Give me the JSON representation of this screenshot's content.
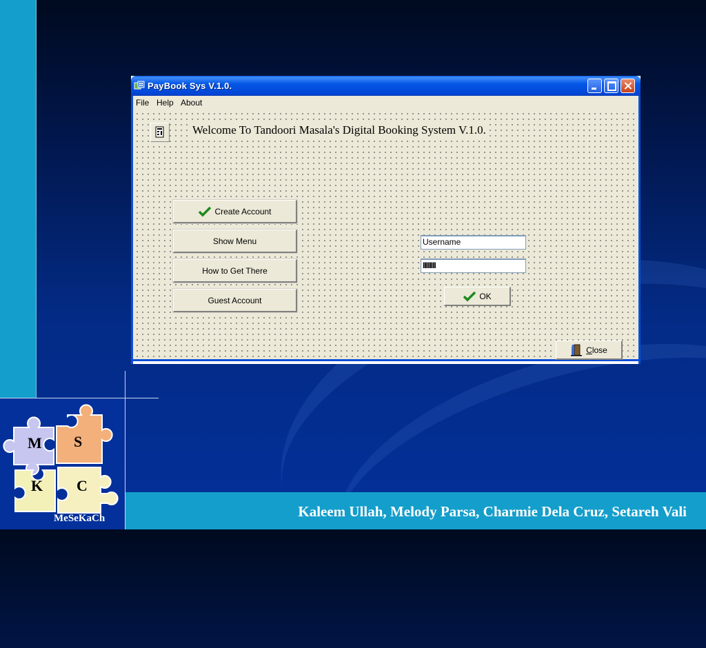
{
  "window": {
    "title": "PayBook Sys V.1.0.",
    "menu": [
      "File",
      "Help",
      "About"
    ],
    "welcome_text": "Welcome To Tandoori Masala's Digital Booking System V.1.0.",
    "buttons": {
      "create_account": "Create Account",
      "show_menu": "Show Menu",
      "how_to_get_there": "How to Get There",
      "guest_account": "Guest Account",
      "ok": "OK",
      "close_first": "C",
      "close_rest": "lose"
    },
    "username_value": "Username",
    "password_value": "IIIIIIII"
  },
  "slide": {
    "footer_text": "Kaleem Ullah, Melody Parsa, Charmie Dela Cruz, Setareh Vali",
    "logo_letters": [
      "M",
      "S",
      "K",
      "C"
    ],
    "logo_caption": "MeSeKaCh"
  },
  "colors": {
    "accent_strip": "#149ecb",
    "background": "#03309a",
    "xp_title": "#0557e6",
    "check": "#1f8a1f"
  },
  "icons": [
    "app-icon",
    "form-icon",
    "check-icon",
    "door-exit-icon"
  ]
}
